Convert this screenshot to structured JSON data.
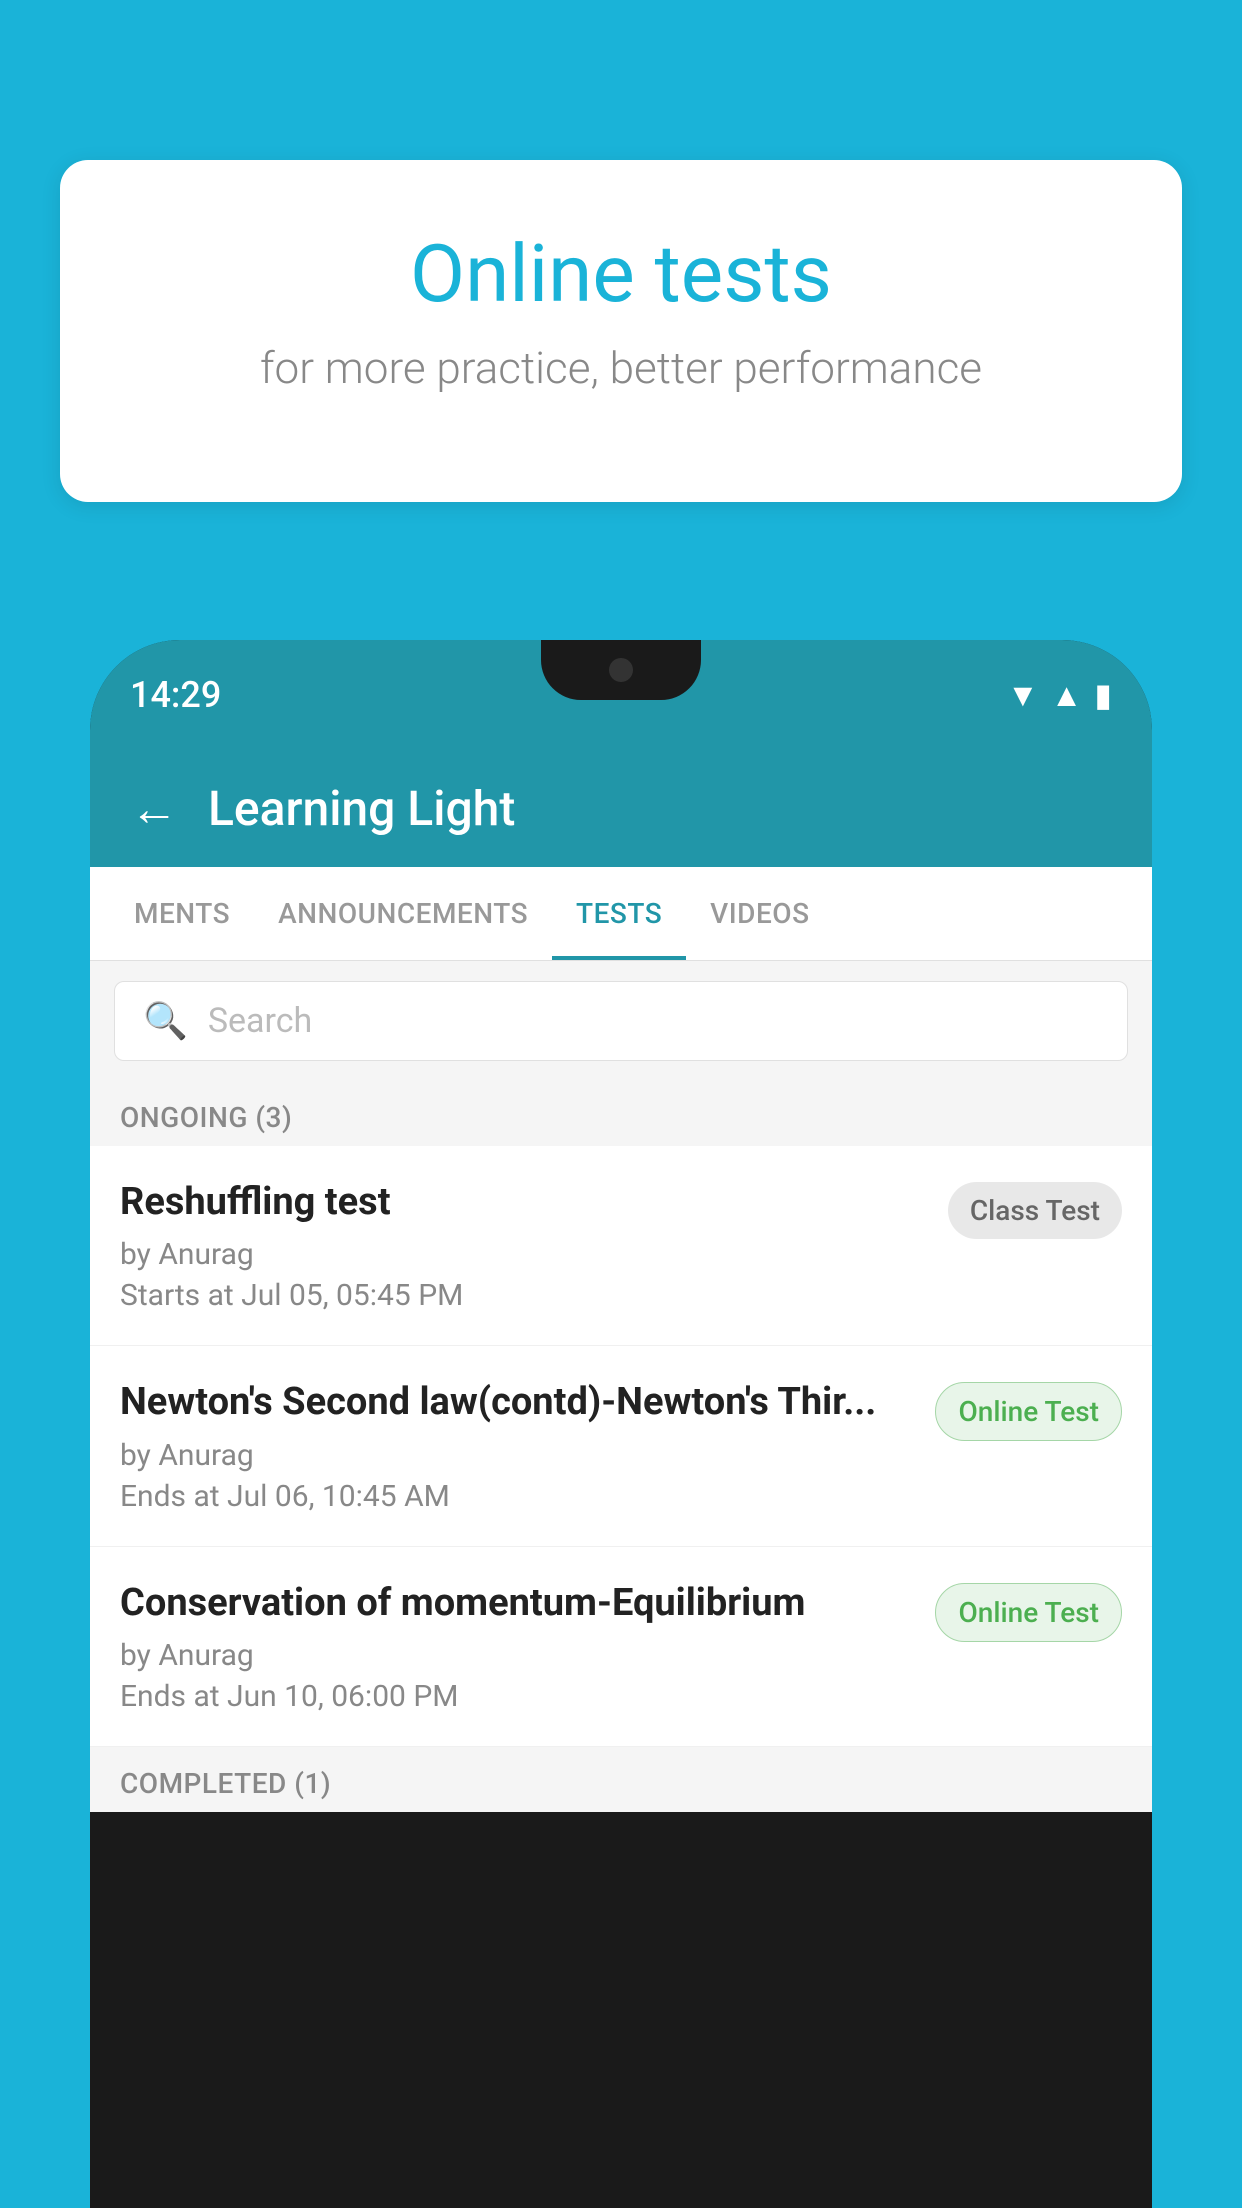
{
  "background_color": "#1ab3d8",
  "speech_bubble": {
    "title": "Online tests",
    "subtitle": "for more practice, better performance"
  },
  "phone": {
    "time": "14:29",
    "status_icons": [
      "wifi",
      "signal",
      "battery"
    ]
  },
  "app": {
    "title": "Learning Light",
    "back_label": "←"
  },
  "tabs": [
    {
      "label": "MENTS",
      "active": false
    },
    {
      "label": "ANNOUNCEMENTS",
      "active": false
    },
    {
      "label": "TESTS",
      "active": true
    },
    {
      "label": "VIDEOS",
      "active": false
    }
  ],
  "search": {
    "placeholder": "Search"
  },
  "ongoing_section": {
    "label": "ONGOING (3)"
  },
  "tests": [
    {
      "title": "Reshuffling test",
      "author": "by Anurag",
      "date": "Starts at  Jul 05, 05:45 PM",
      "badge": "Class Test",
      "badge_type": "class"
    },
    {
      "title": "Newton's Second law(contd)-Newton's Thir...",
      "author": "by Anurag",
      "date": "Ends at  Jul 06, 10:45 AM",
      "badge": "Online Test",
      "badge_type": "online"
    },
    {
      "title": "Conservation of momentum-Equilibrium",
      "author": "by Anurag",
      "date": "Ends at  Jun 10, 06:00 PM",
      "badge": "Online Test",
      "badge_type": "online"
    }
  ],
  "completed_section": {
    "label": "COMPLETED (1)"
  }
}
